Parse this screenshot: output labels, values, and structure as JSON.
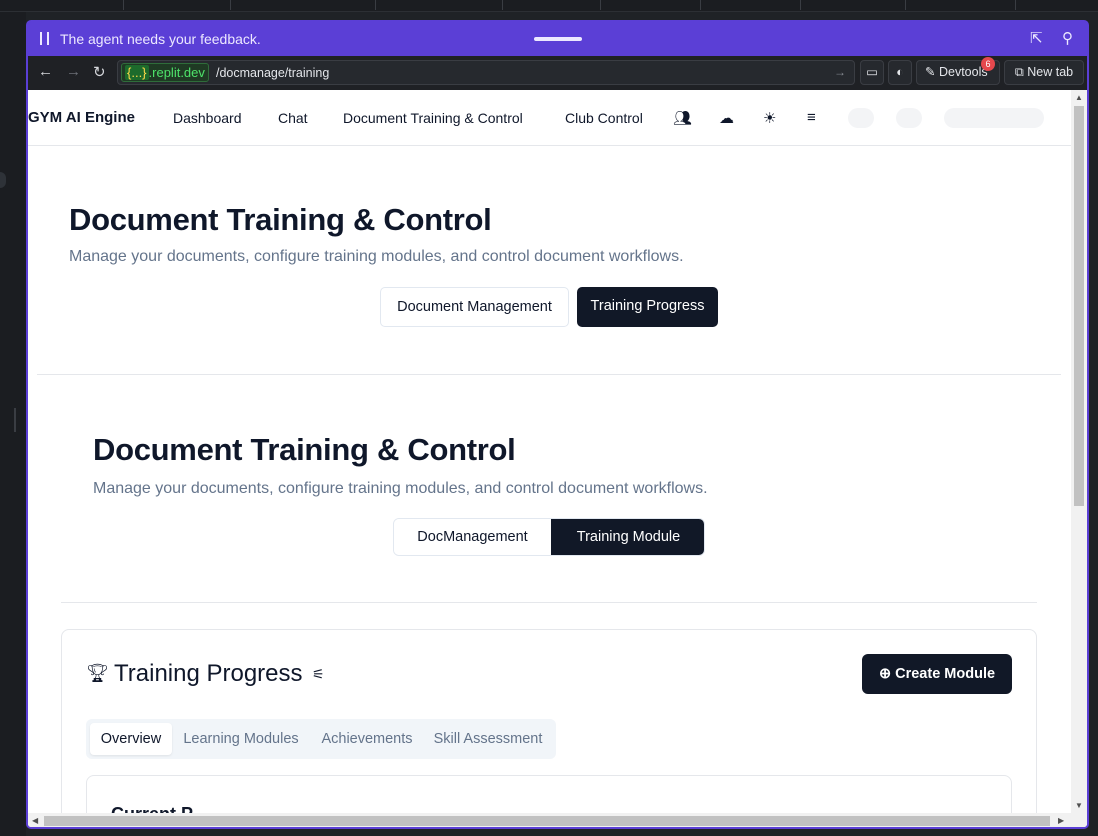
{
  "agent_bar": {
    "message": "The agent needs your feedback.",
    "pause_icon": "pause-icon",
    "popout_icon": "popout-icon",
    "pin_icon": "pin-icon"
  },
  "browser": {
    "url_domain_highlight": "{...}",
    "url_domain_rest": ".replit.dev",
    "url_path": "/docmanage/training",
    "devtools_label": "Devtools",
    "devtools_badge": "6",
    "new_tab_label": "New tab"
  },
  "app": {
    "brand": "GYM AI Engine",
    "nav": {
      "dashboard": "Dashboard",
      "chat": "Chat",
      "doc_training": "Document Training & Control",
      "club_control": "Club Control"
    }
  },
  "section1": {
    "title": "Document Training & Control",
    "subtitle": "Manage your documents, configure training modules, and control document workflows.",
    "tab_doc_management": "Document Management",
    "tab_training_progress": "Training Progress",
    "active_tab": "Training Progress"
  },
  "section2": {
    "title": "Document Training & Control",
    "subtitle": "Manage your documents, configure training modules, and control document workflows.",
    "tab_docmanagement": "DocManagement",
    "tab_training_module": "Training Module",
    "active_tab": "Training Module"
  },
  "progress": {
    "title": "Training Progress",
    "create_button": "Create Module",
    "tabs": {
      "overview": "Overview",
      "learning_modules": "Learning Modules",
      "achievements": "Achievements",
      "skill_assessment": "Skill Assessment"
    },
    "active_tab": "Overview",
    "card_title_partial": "Current P"
  },
  "colors": {
    "agent_purple": "#5b3fd6",
    "primary_dark": "#111827",
    "muted_text": "#64748b"
  }
}
